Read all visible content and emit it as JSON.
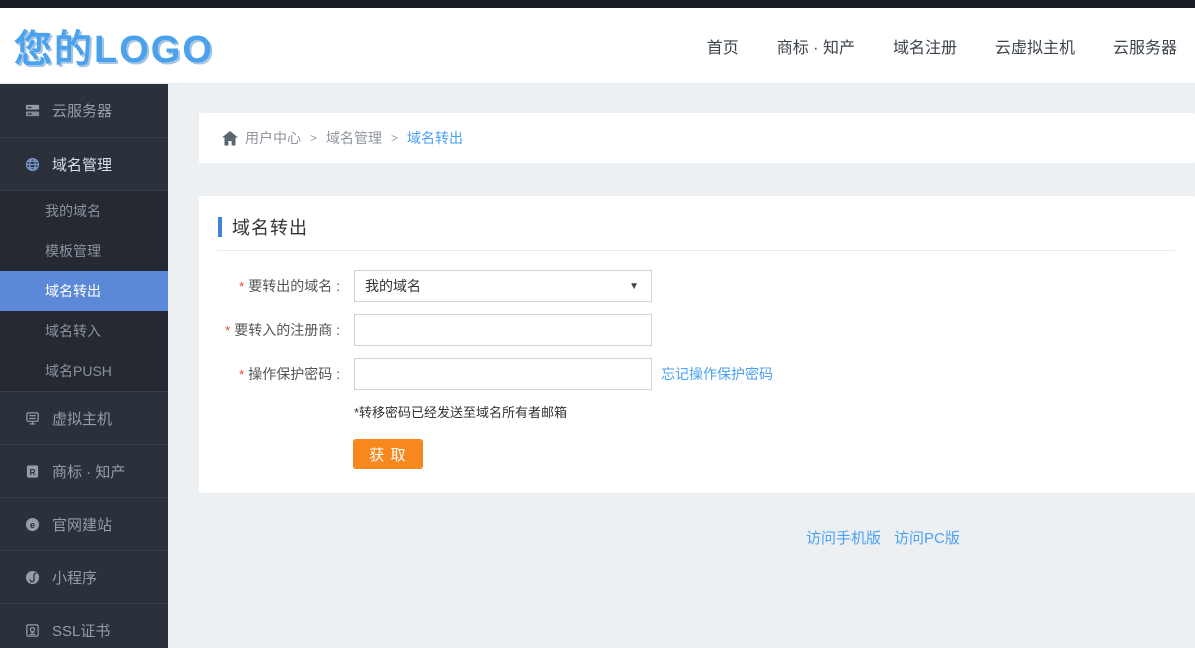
{
  "brand": {
    "logo_text": "您的LOGO"
  },
  "top_nav": {
    "items": [
      {
        "label": "首页"
      },
      {
        "label": "商标 · 知产"
      },
      {
        "label": "域名注册"
      },
      {
        "label": "云虚拟主机"
      },
      {
        "label": "云服务器"
      }
    ]
  },
  "sidebar": {
    "items": [
      {
        "label": "云服务器",
        "icon": "cloud-server-icon"
      },
      {
        "label": "域名管理",
        "icon": "globe-icon",
        "active": true,
        "children": [
          {
            "label": "我的域名"
          },
          {
            "label": "模板管理"
          },
          {
            "label": "域名转出",
            "active": true
          },
          {
            "label": "域名转入"
          },
          {
            "label": "域名PUSH"
          }
        ]
      },
      {
        "label": "虚拟主机",
        "icon": "virtual-host-icon"
      },
      {
        "label": "商标 · 知产",
        "icon": "trademark-icon"
      },
      {
        "label": "官网建站",
        "icon": "website-builder-icon"
      },
      {
        "label": "小程序",
        "icon": "mini-program-icon"
      },
      {
        "label": "SSL证书",
        "icon": "ssl-certificate-icon"
      }
    ]
  },
  "breadcrumb": {
    "separator": ">",
    "items": [
      {
        "label": "用户中心"
      },
      {
        "label": "域名管理"
      },
      {
        "label": "域名转出",
        "current": true
      }
    ]
  },
  "panel": {
    "title": "域名转出",
    "form": {
      "required_mark": "*",
      "fields": [
        {
          "label": "要转出的域名 :",
          "type": "select",
          "value": "我的域名"
        },
        {
          "label": "要转入的注册商 :",
          "type": "text",
          "value": ""
        },
        {
          "label": "操作保护密码 :",
          "type": "text",
          "value": "",
          "link": "忘记操作保护密码"
        }
      ],
      "select_arrow": "▼",
      "note": "*转移密码已经发送至域名所有者邮箱",
      "submit_label": "获 取"
    }
  },
  "footer": {
    "links": [
      {
        "label": "访问手机版"
      },
      {
        "label": "访问PC版"
      }
    ]
  },
  "colors": {
    "top_strip": "#191d24",
    "logo_blue": "#4aa2ec",
    "sidebar_bg": "#2b313a",
    "submenu_bg": "#242932",
    "active_item_blue": "#5c88d8",
    "title_bar_blue": "#4285d8",
    "link_blue": "#4aa0f2",
    "button_orange": "#f6881d",
    "content_bg": "#edf0f2"
  }
}
